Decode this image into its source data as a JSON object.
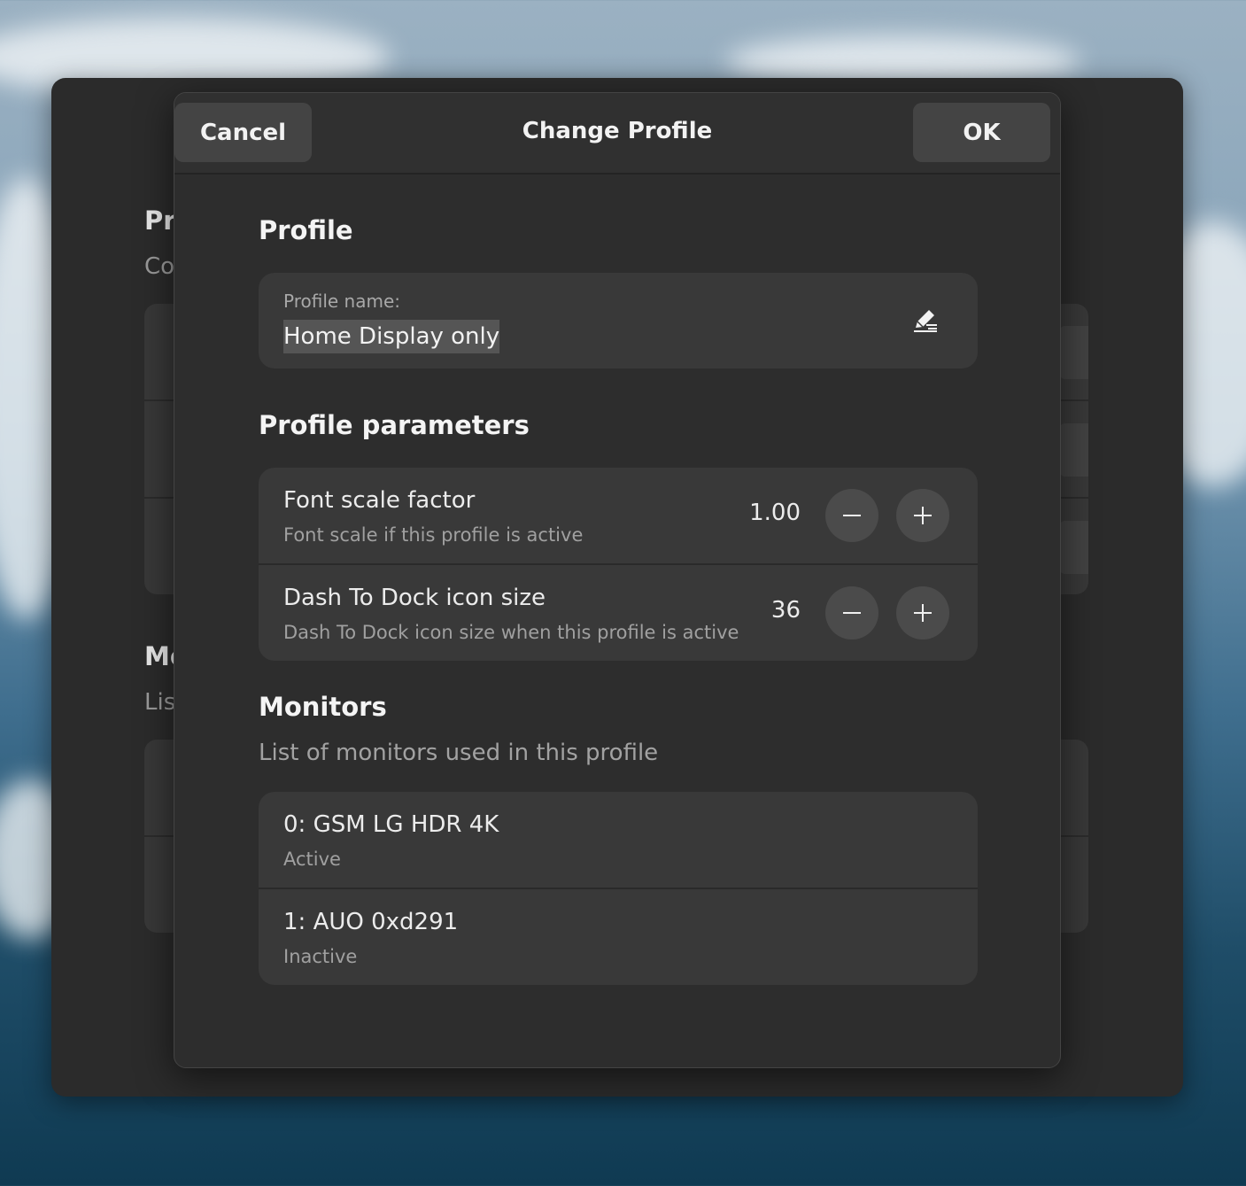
{
  "background_window": {
    "section1_fragment": "Pr",
    "section1_desc_fragment": "Co",
    "section2_fragment": "Mo",
    "section2_desc_fragment": "Lis"
  },
  "dialog": {
    "title": "Change Profile",
    "cancel_label": "Cancel",
    "ok_label": "OK"
  },
  "profile": {
    "heading": "Profile",
    "name_label": "Profile name:",
    "name_value": "Home Display only"
  },
  "parameters": {
    "heading": "Profile parameters",
    "rows": [
      {
        "title": "Font scale factor",
        "subtitle": "Font scale if this profile is active",
        "value": "1.00"
      },
      {
        "title": "Dash To Dock icon size",
        "subtitle": "Dash To Dock icon size when this profile is active",
        "value": "36"
      }
    ]
  },
  "monitors": {
    "heading": "Monitors",
    "description": "List of monitors used in this profile",
    "items": [
      {
        "name": "0: GSM LG HDR 4K",
        "status": "Active"
      },
      {
        "name": "1: AUO 0xd291",
        "status": "Inactive"
      }
    ]
  },
  "colors": {
    "dialog_bg": "#2d2d2d",
    "card_bg": "#393939",
    "button_bg": "#444444",
    "text_primary": "#f2f2f2",
    "text_secondary": "#a0a0a0"
  },
  "icons": {
    "edit": "edit-pencil-icon",
    "minus": "minus-icon",
    "plus": "plus-icon"
  }
}
